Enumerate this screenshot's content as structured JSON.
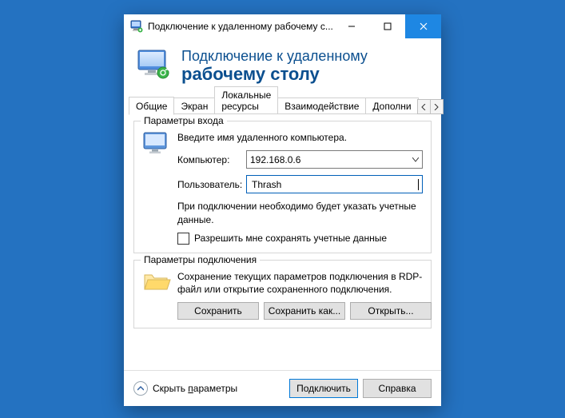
{
  "window": {
    "title_truncated": "Подключение к удаленному рабочему с..."
  },
  "banner": {
    "line1": "Подключение к удаленному",
    "line2": "рабочему столу"
  },
  "tabs": {
    "items": [
      "Общие",
      "Экран",
      "Локальные ресурсы",
      "Взаимодействие",
      "Дополни"
    ],
    "active_index": 0
  },
  "group_login": {
    "title": "Параметры входа",
    "intro": "Введите имя удаленного компьютера.",
    "computer_label": "Компьютер:",
    "computer_value": "192.168.0.6",
    "user_label": "Пользователь:",
    "user_value": "Thrash",
    "note": "При подключении необходимо будет указать учетные данные.",
    "checkbox_label": "Разрешить мне сохранять учетные данные",
    "checkbox_checked": false
  },
  "group_conn": {
    "title": "Параметры подключения",
    "text": "Сохранение текущих параметров подключения в RDP-файл или открытие сохраненного подключения.",
    "save_label": "Сохранить",
    "save_as_label": "Сохранить как...",
    "open_label": "Открыть..."
  },
  "footer": {
    "hide_params_prefix": "Скрыть ",
    "hide_params_underlined": "п",
    "hide_params_suffix": "араметры",
    "connect_label": "Подключить",
    "help_label": "Справка"
  },
  "colors": {
    "brand": "#0b4f8f",
    "close_bg": "#1e87e3"
  }
}
